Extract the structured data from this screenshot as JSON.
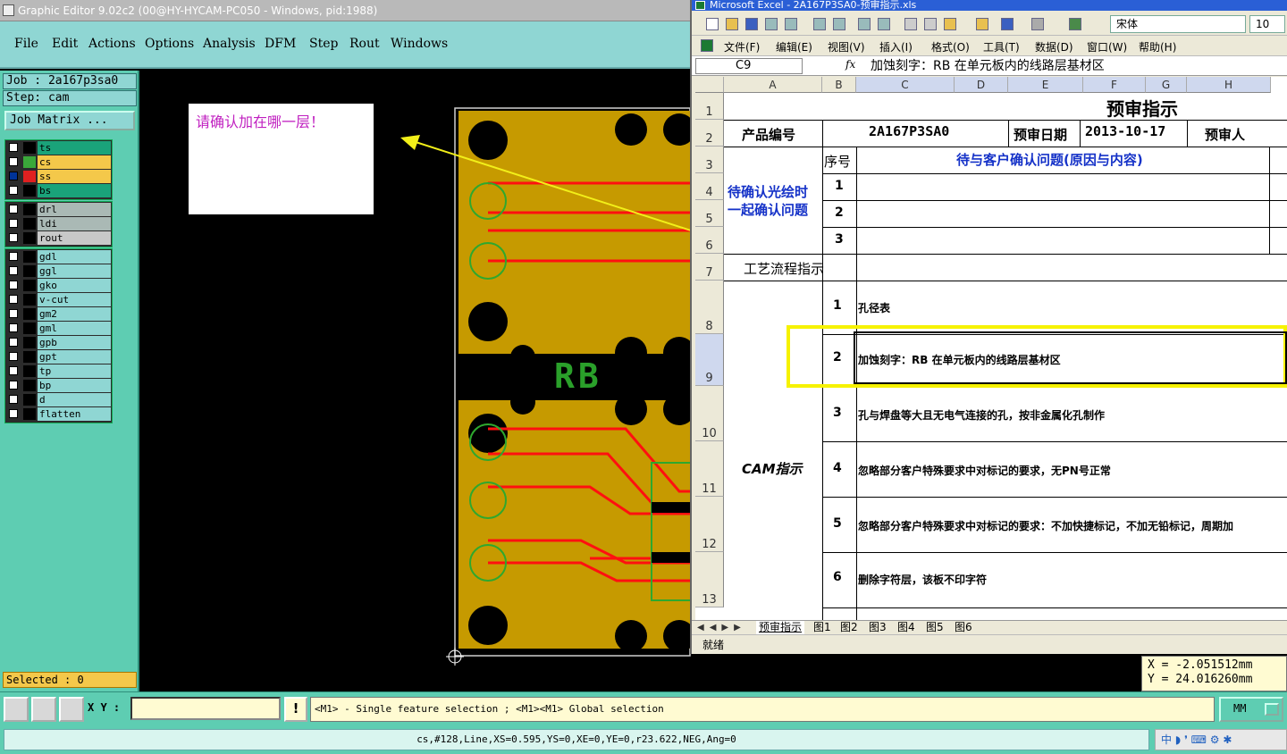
{
  "cam": {
    "title": "Graphic Editor 9.02c2 (00@HY-HYCAM-PC050 - Windows, pid:1988)",
    "menu": [
      "File",
      "Edit",
      "Actions",
      "Options",
      "Analysis",
      "DFM",
      "Step",
      "Rout",
      "Windows"
    ],
    "job_label": "Job : 2a167p3sa0",
    "step_label": "Step: cam",
    "job_matrix": "Job Matrix ...",
    "layer_groups": [
      [
        {
          "name": "ts",
          "color": "#1aa37a",
          "chip": "#000000",
          "checked": false
        },
        {
          "name": "cs",
          "color": "#f4c84a",
          "chip": "#3aa83a",
          "checked": false
        },
        {
          "name": "ss",
          "color": "#f4c84a",
          "chip": "#e02020",
          "checked": true
        },
        {
          "name": "bs",
          "color": "#1aa37a",
          "chip": "#000000",
          "checked": false
        }
      ],
      [
        {
          "name": "drl",
          "color": "#aab9b5",
          "chip": "#000000",
          "checked": false
        },
        {
          "name": "ldi",
          "color": "#aab9b5",
          "chip": "#000000",
          "checked": false
        },
        {
          "name": "rout",
          "color": "#c8c8c8",
          "chip": "#000000",
          "checked": false
        }
      ],
      [
        {
          "name": "gdl",
          "color": "#8fd6d3",
          "chip": "#000000",
          "checked": false
        },
        {
          "name": "ggl",
          "color": "#8fd6d3",
          "chip": "#000000",
          "checked": false
        },
        {
          "name": "gko",
          "color": "#8fd6d3",
          "chip": "#000000",
          "checked": false
        },
        {
          "name": "v-cut",
          "color": "#8fd6d3",
          "chip": "#000000",
          "checked": false
        },
        {
          "name": "gm2",
          "color": "#8fd6d3",
          "chip": "#000000",
          "checked": false
        },
        {
          "name": "gml",
          "color": "#8fd6d3",
          "chip": "#000000",
          "checked": false
        },
        {
          "name": "gpb",
          "color": "#8fd6d3",
          "chip": "#000000",
          "checked": false
        },
        {
          "name": "gpt",
          "color": "#8fd6d3",
          "chip": "#000000",
          "checked": false
        },
        {
          "name": "tp",
          "color": "#8fd6d3",
          "chip": "#000000",
          "checked": false
        },
        {
          "name": "bp",
          "color": "#8fd6d3",
          "chip": "#000000",
          "checked": false
        },
        {
          "name": "d",
          "color": "#8fd6d3",
          "chip": "#000000",
          "checked": false
        },
        {
          "name": "flatten",
          "color": "#8fd6d3",
          "chip": "#000000",
          "checked": false
        }
      ]
    ],
    "selected": "Selected : 0",
    "note": "请确认加在哪一层！",
    "board_text": "RB",
    "xy_label": "X Y :",
    "xy_value": "",
    "warn": "!",
    "hint": "<M1> - Single feature selection ; <M1><M1> Global selection",
    "units": "MM",
    "coord_x": "X  =  -2.051512mm",
    "coord_y": "Y  =  24.016260mm",
    "feature": "cs,#128,Line,XS=0.595,YS=0,XE=0,YE=0,r23.622,NEG,Ang=0",
    "ime": "中 ◗ ❜ ⌨ ⚙ ✱",
    "colors": {
      "board": "#c69a00",
      "trace": "#ff1010",
      "pad_ring": "#2ea82e",
      "arrow": "#f2ef19"
    }
  },
  "excel": {
    "title": "Microsoft Excel - 2A167P3SA0-预审指示.xls",
    "font": "宋体",
    "size": "10",
    "menu": [
      "文件(F)",
      "编辑(E)",
      "视图(V)",
      "插入(I)",
      "格式(O)",
      "工具(T)",
      "数据(D)",
      "窗口(W)",
      "帮助(H)"
    ],
    "name_box": "C9",
    "fx": "fx",
    "formula": "加蚀刻字：RB 在单元板内的线路层基材区",
    "columns": [
      "A",
      "B",
      "C",
      "D",
      "E",
      "F",
      "G",
      "H"
    ],
    "rows": [
      "1",
      "2",
      "3",
      "4",
      "5",
      "6",
      "7",
      "8",
      "9",
      "10",
      "11",
      "12",
      "13"
    ],
    "sheet_title": "预审指示",
    "product_no_label": "产品编号",
    "product_no": "2A167P3SA0",
    "review_date_label": "预审日期",
    "review_date": "2013-10-17",
    "reviewer_label": "预审人",
    "seq_label": "序号",
    "question_header": "待与客户确认问题(原因与内容)",
    "confirm_label_1": "待确认光绘时",
    "confirm_label_2": "一起确认问题",
    "confirm_nums": [
      "1",
      "2",
      "3"
    ],
    "process_label": "工艺流程指示",
    "cam_label": "CAM指示",
    "cam_items": [
      {
        "no": "1",
        "text": "孔径表"
      },
      {
        "no": "2",
        "text": "加蚀刻字：RB 在单元板内的线路层基材区"
      },
      {
        "no": "3",
        "text": "孔与焊盘等大且无电气连接的孔，按非金属化孔制作"
      },
      {
        "no": "4",
        "text": "忽略部分客户特殊要求中对标记的要求，无PN号正常"
      },
      {
        "no": "5",
        "text": "忽略部分客户特殊要求中对标记的要求：不加快捷标记，不加无铅标记，周期加"
      },
      {
        "no": "6",
        "text": "删除字符层，该板不印字符"
      }
    ],
    "tabs": [
      "预审指示",
      "图1",
      "图2",
      "图3",
      "图4",
      "图5",
      "图6"
    ],
    "status": "就绪"
  }
}
